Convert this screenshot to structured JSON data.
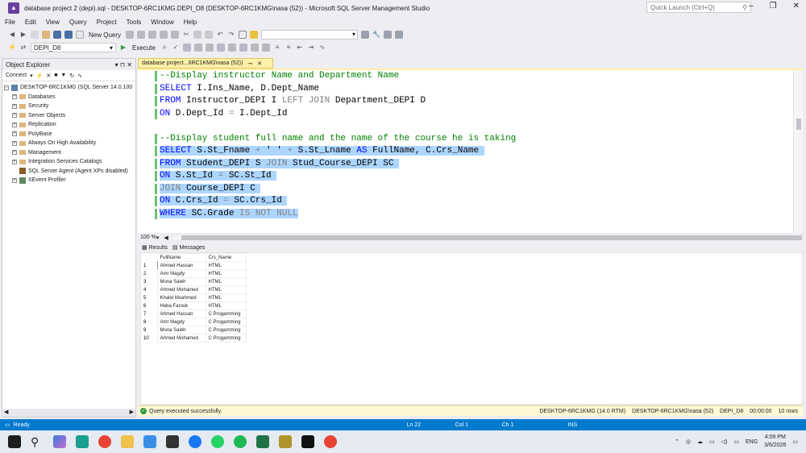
{
  "window": {
    "title": "database project 2 (depi).sql - DESKTOP-6RC1KMG.DEPI_D8 (DESKTOP-6RC1KMG\\nasa (52)) - Microsoft SQL Server Management Studio",
    "quick_launch_placeholder": "Quick Launch (Ctrl+Q)"
  },
  "menu": [
    "File",
    "Edit",
    "View",
    "Query",
    "Project",
    "Tools",
    "Window",
    "Help"
  ],
  "toolbar": {
    "new_query": "New Query",
    "database": "DEPI_D8",
    "execute": "Execute"
  },
  "object_explorer": {
    "title": "Object Explorer",
    "connect": "Connect",
    "server": "DESKTOP-6RC1KMG (SQL Server 14.0.100",
    "nodes": [
      "Databases",
      "Security",
      "Server Objects",
      "Replication",
      "PolyBase",
      "Always On High Availability",
      "Management",
      "Integration Services Catalogs",
      "SQL Server Agent (Agent XPs disabled)",
      "XEvent Profiler"
    ]
  },
  "doc_tab": {
    "label": "database project...6RC1KMG\\nasa (52))"
  },
  "editor": {
    "lines": [
      [
        {
          "t": "--Display instructor Name and Department Name",
          "c": "cm"
        }
      ],
      [
        {
          "t": "SELECT",
          "c": "kw"
        },
        {
          "t": " I.Ins_Name, D.Dept_Name",
          "c": "id"
        }
      ],
      [
        {
          "t": "FROM",
          "c": "kw"
        },
        {
          "t": " Instructor_DEPI I ",
          "c": "id"
        },
        {
          "t": "LEFT JOIN",
          "c": "gr"
        },
        {
          "t": " Department_DEPI D",
          "c": "id"
        }
      ],
      [
        {
          "t": "ON",
          "c": "kw"
        },
        {
          "t": " D.Dept_Id ",
          "c": "id"
        },
        {
          "t": "=",
          "c": "gr"
        },
        {
          "t": " I.Dept_Id",
          "c": "id"
        }
      ],
      [
        {
          "t": " ",
          "c": "id"
        }
      ],
      [
        {
          "t": "--Display student full name and the name of the course he is taking",
          "c": "cm"
        }
      ],
      [
        {
          "t": "SELECT",
          "c": "kw"
        },
        {
          "t": " S.St_Fname ",
          "c": "id"
        },
        {
          "t": "+",
          "c": "gr"
        },
        {
          "t": " ",
          "c": "id"
        },
        {
          "t": "' '",
          "c": "id"
        },
        {
          "t": " ",
          "c": "id"
        },
        {
          "t": "+",
          "c": "gr"
        },
        {
          "t": " S.St_Lname ",
          "c": "id"
        },
        {
          "t": "AS",
          "c": "kw"
        },
        {
          "t": " FullName, C.Crs_Name ",
          "c": "id"
        }
      ],
      [
        {
          "t": "FROM",
          "c": "kw"
        },
        {
          "t": " Student_DEPI S ",
          "c": "id"
        },
        {
          "t": "JOIN",
          "c": "gr"
        },
        {
          "t": " Stud_Course_DEPI SC ",
          "c": "id"
        }
      ],
      [
        {
          "t": "ON",
          "c": "kw"
        },
        {
          "t": " S.St_Id ",
          "c": "id"
        },
        {
          "t": "=",
          "c": "gr"
        },
        {
          "t": " SC.St_Id ",
          "c": "id"
        }
      ],
      [
        {
          "t": "JOIN",
          "c": "gr"
        },
        {
          "t": " Course_DEPI C ",
          "c": "id"
        }
      ],
      [
        {
          "t": "ON",
          "c": "kw"
        },
        {
          "t": " C.Crs_Id ",
          "c": "id"
        },
        {
          "t": "=",
          "c": "gr"
        },
        {
          "t": " SC.Crs_Id ",
          "c": "id"
        }
      ],
      [
        {
          "t": "WHERE",
          "c": "kw"
        },
        {
          "t": " SC.Grade ",
          "c": "id"
        },
        {
          "t": "IS NOT NULL",
          "c": "gr"
        }
      ]
    ],
    "highlight_from": 6,
    "zoom": "100 %"
  },
  "results": {
    "tabs": [
      "Results",
      "Messages"
    ],
    "columns": [
      "FullName",
      "Crs_Name"
    ],
    "rows": [
      [
        "1",
        "Ahmed Hassan",
        "HTML"
      ],
      [
        "2",
        "Amr Magdy",
        "HTML"
      ],
      [
        "3",
        "Mona Saleh",
        "HTML"
      ],
      [
        "4",
        "Ahmed Mohamed",
        "HTML"
      ],
      [
        "5",
        "Khalid Moahmed",
        "HTML"
      ],
      [
        "6",
        "Heba Farouk",
        "HTML"
      ],
      [
        "7",
        "Ahmed Hassan",
        "C Progamming"
      ],
      [
        "8",
        "Amr Magdy",
        "C Progamming"
      ],
      [
        "9",
        "Mona Saleh",
        "C Progamming"
      ],
      [
        "10",
        "Ahmed Mohamed",
        "C Progamming"
      ]
    ]
  },
  "query_status": {
    "message": "Query executed successfully.",
    "server": "DESKTOP-6RC1KMG (14.0 RTM)",
    "user": "DESKTOP-6RC1KMG\\nasa (52)",
    "database": "DEPI_D8",
    "time": "00:00:00",
    "rows": "10 rows"
  },
  "statusbar": {
    "ready": "Ready",
    "ln": "Ln 22",
    "col": "Col 1",
    "ch": "Ch 1",
    "ins": "INS"
  },
  "taskbar": {
    "lang": "ENG",
    "time": "4:09 PM",
    "date": "3/6/2026"
  },
  "colors": {
    "accent": "#007acc",
    "selection": "#add6ff",
    "keyword": "#0000ff",
    "comment": "#008000",
    "doc_tab": "#fff1a8"
  }
}
